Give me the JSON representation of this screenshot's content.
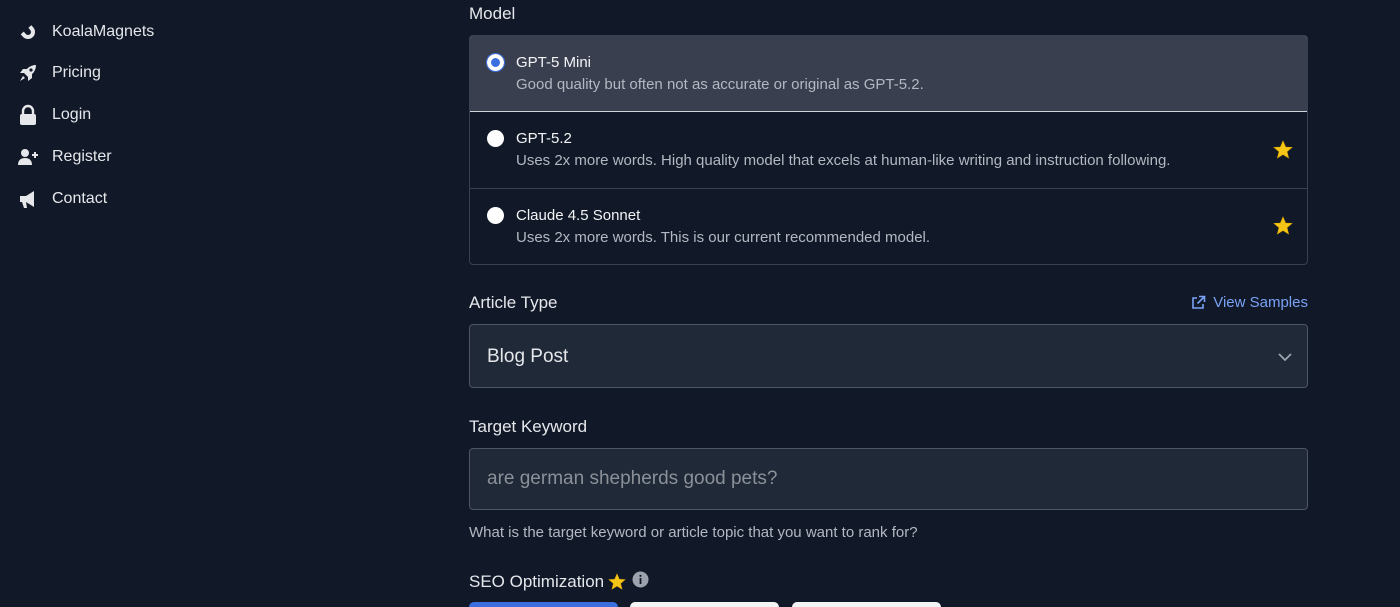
{
  "sidebar": {
    "items": [
      {
        "label": "KoalaMagnets",
        "icon": "magnet-icon"
      },
      {
        "label": "Pricing",
        "icon": "rocket-icon"
      },
      {
        "label": "Login",
        "icon": "lock-icon"
      },
      {
        "label": "Register",
        "icon": "user-plus-icon"
      },
      {
        "label": "Contact",
        "icon": "megaphone-icon"
      }
    ]
  },
  "form": {
    "model_label": "Model",
    "models": [
      {
        "title": "GPT-5 Mini",
        "desc": "Good quality but often not as accurate or original as GPT-5.2.",
        "selected": true,
        "starred": false
      },
      {
        "title": "GPT-5.2",
        "desc": "Uses 2x more words. High quality model that excels at human-like writing and instruction following.",
        "selected": false,
        "starred": true
      },
      {
        "title": "Claude 4.5 Sonnet",
        "desc": "Uses 2x more words. This is our current recommended model.",
        "selected": false,
        "starred": true
      }
    ],
    "article_type_label": "Article Type",
    "view_samples": "View Samples",
    "article_type_value": "Blog Post",
    "target_keyword_label": "Target Keyword",
    "target_keyword_placeholder": "are german shepherds good pets?",
    "target_keyword_help": "What is the target keyword or article topic that you want to rank for?",
    "seo_label": "SEO Optimization"
  },
  "colors": {
    "background": "#111827",
    "accent": "#3b6fe0",
    "link": "#7aa2f7",
    "star": "#f5c518"
  }
}
